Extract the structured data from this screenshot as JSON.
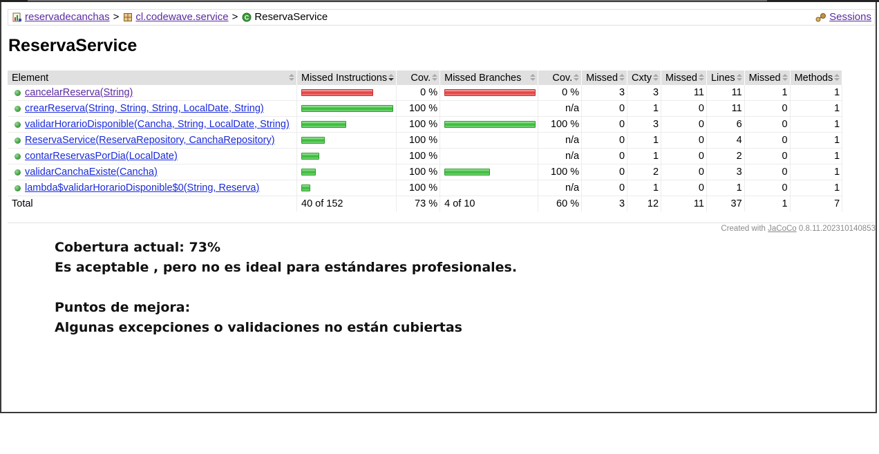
{
  "breadcrumb": {
    "items": [
      {
        "label": "reservadecanchas"
      },
      {
        "label": "cl.codewave.service"
      }
    ],
    "separator": ">",
    "current": "ReservaService",
    "sessions_label": "Sessions"
  },
  "page_title": "ReservaService",
  "table": {
    "headers": [
      "Element",
      "Missed Instructions",
      "Cov.",
      "Missed Branches",
      "Cov.",
      "Missed",
      "Cxty",
      "Missed",
      "Lines",
      "Missed",
      "Methods"
    ],
    "rows": [
      {
        "element": "cancelarReserva(String)",
        "instr_missed_fraction": 1.0,
        "instr_cov": "0 %",
        "branch_missed_fraction": 1.0,
        "branch_cov": "0 %",
        "missed_cxty": "3",
        "cxty": "3",
        "missed_lines": "11",
        "lines": "11",
        "missed_methods": "1",
        "methods": "1",
        "instr_bar_units": 40,
        "branch_bar_units": 4
      },
      {
        "element": "crearReserva(String, String, String, LocalDate, String)",
        "instr_cov": "100 %",
        "branch_cov": "n/a",
        "missed_cxty": "0",
        "cxty": "1",
        "missed_lines": "0",
        "lines": "11",
        "missed_methods": "0",
        "methods": "1",
        "instr_bar_units": 51,
        "branch_bar_units": 0
      },
      {
        "element": "validarHorarioDisponible(Cancha, String, LocalDate, String)",
        "instr_cov": "100 %",
        "branch_cov": "100 %",
        "missed_cxty": "0",
        "cxty": "3",
        "missed_lines": "0",
        "lines": "6",
        "missed_methods": "0",
        "methods": "1",
        "instr_bar_units": 25,
        "branch_bar_units": 4
      },
      {
        "element": "ReservaService(ReservaRepository, CanchaRepository)",
        "instr_cov": "100 %",
        "branch_cov": "n/a",
        "missed_cxty": "0",
        "cxty": "1",
        "missed_lines": "0",
        "lines": "4",
        "missed_methods": "0",
        "methods": "1",
        "instr_bar_units": 13,
        "branch_bar_units": 0
      },
      {
        "element": "contarReservasPorDia(LocalDate)",
        "instr_cov": "100 %",
        "branch_cov": "n/a",
        "missed_cxty": "0",
        "cxty": "1",
        "missed_lines": "0",
        "lines": "2",
        "missed_methods": "0",
        "methods": "1",
        "instr_bar_units": 10,
        "branch_bar_units": 0
      },
      {
        "element": "validarCanchaExiste(Cancha)",
        "instr_cov": "100 %",
        "branch_cov": "100 %",
        "missed_cxty": "0",
        "cxty": "2",
        "missed_lines": "0",
        "lines": "3",
        "missed_methods": "0",
        "methods": "1",
        "instr_bar_units": 8,
        "branch_bar_units": 2
      },
      {
        "element": "lambda$validarHorarioDisponible$0(String, Reserva)",
        "instr_cov": "100 %",
        "branch_cov": "n/a",
        "missed_cxty": "0",
        "cxty": "1",
        "missed_lines": "0",
        "lines": "1",
        "missed_methods": "0",
        "methods": "1",
        "instr_bar_units": 5,
        "branch_bar_units": 0
      }
    ],
    "total": {
      "label": "Total",
      "instr": "40 of 152",
      "instr_cov": "73 %",
      "branch": "4 of 10",
      "branch_cov": "60 %",
      "missed_cxty": "3",
      "cxty": "12",
      "missed_lines": "11",
      "lines": "37",
      "missed_methods": "1",
      "methods": "7"
    }
  },
  "footer": {
    "prefix": "Created with",
    "link": "JaCoCo",
    "version": "0.8.11.202310140853"
  },
  "notes": {
    "line1": "Cobertura actual: 73%",
    "line2": "Es aceptable , pero no es ideal para estándares profesionales.",
    "line3": "Puntos de mejora:",
    "line4": "Algunas excepciones o validaciones no están cubiertas"
  },
  "colors": {
    "missed_bar": "#e53a3a",
    "covered_bar": "#32b832",
    "link": "#1a2ad8",
    "visited_link": "#5a2aa0",
    "header_bg": "#e0e0e0"
  }
}
